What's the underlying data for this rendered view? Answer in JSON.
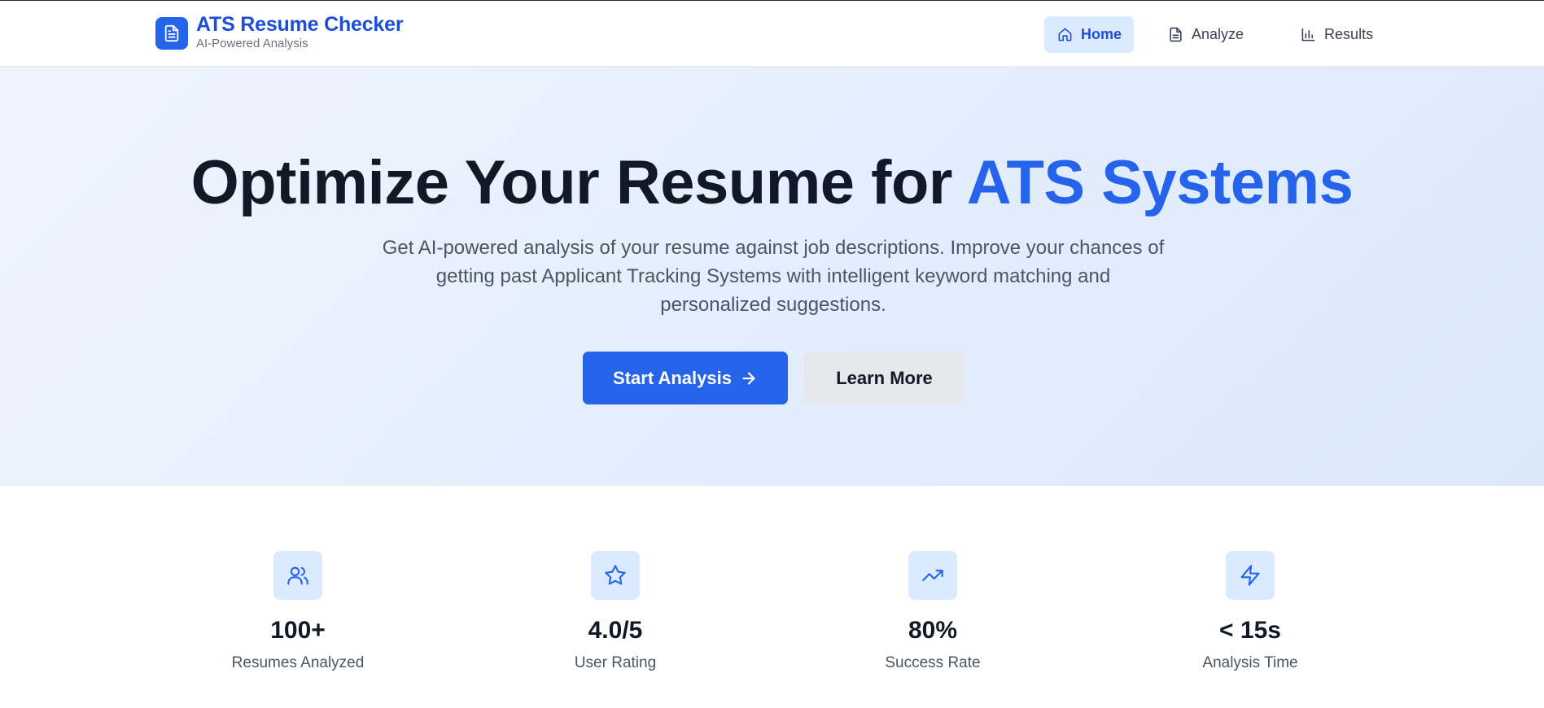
{
  "brand": {
    "title": "ATS Resume Checker",
    "subtitle": "AI-Powered Analysis",
    "icon": "document-icon"
  },
  "nav": {
    "items": [
      {
        "label": "Home",
        "icon": "home-icon",
        "active": true
      },
      {
        "label": "Analyze",
        "icon": "document-icon",
        "active": false
      },
      {
        "label": "Results",
        "icon": "bar-chart-icon",
        "active": false
      }
    ]
  },
  "hero": {
    "title_main": "Optimize Your Resume for ",
    "title_accent": "ATS Systems",
    "description": "Get AI-powered analysis of your resume against job descriptions. Improve your chances of getting past Applicant Tracking Systems with intelligent keyword matching and personalized suggestions.",
    "primary_button": "Start Analysis",
    "secondary_button": "Learn More"
  },
  "stats": [
    {
      "value": "100+",
      "label": "Resumes Analyzed",
      "icon": "users-icon"
    },
    {
      "value": "4.0/5",
      "label": "User Rating",
      "icon": "star-icon"
    },
    {
      "value": "80%",
      "label": "Success Rate",
      "icon": "trending-up-icon"
    },
    {
      "value": "< 15s",
      "label": "Analysis Time",
      "icon": "lightning-icon"
    }
  ],
  "colors": {
    "accent": "#2563eb",
    "accent_dark": "#1d4ed8",
    "accent_light": "#dbeafe",
    "text_dark": "#111827",
    "text_muted": "#4b5563"
  }
}
